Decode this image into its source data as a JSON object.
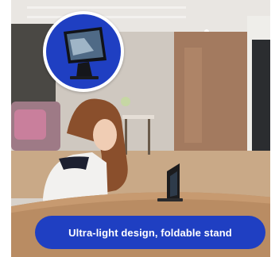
{
  "banner": {
    "caption": "Ultra-light design, foldable stand"
  },
  "colors": {
    "accent": "#1f3fc2",
    "caption_text": "#ffffff"
  },
  "icons": {
    "inset": "tablet-stand-product-icon"
  }
}
